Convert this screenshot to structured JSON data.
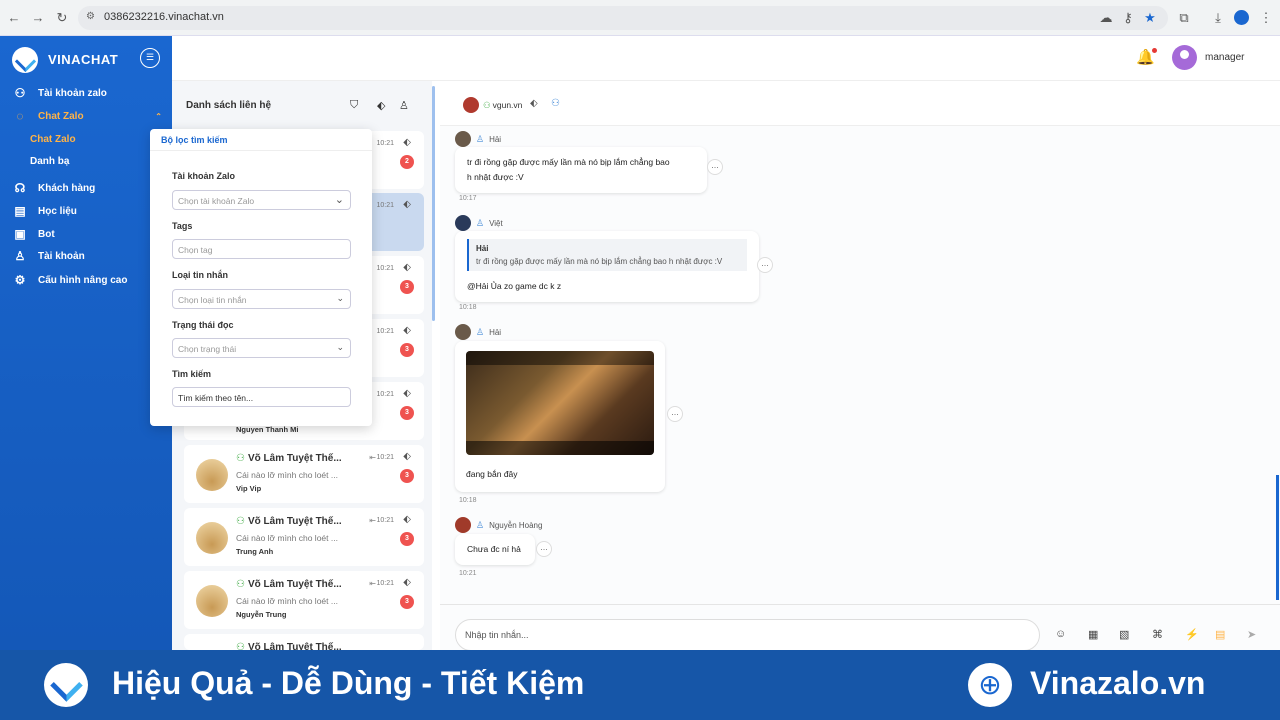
{
  "browser": {
    "url": "0386232216.vinachat.vn"
  },
  "sidebar": {
    "brand": "VINACHAT",
    "items": [
      {
        "label": "Tài khoản zalo"
      },
      {
        "label": "Chat Zalo"
      },
      {
        "label": "Chat Zalo"
      },
      {
        "label": "Danh bạ"
      },
      {
        "label": "Khách hàng"
      },
      {
        "label": "Học liệu"
      },
      {
        "label": "Bot"
      },
      {
        "label": "Tài khoản"
      },
      {
        "label": "Cấu hình nâng cao"
      }
    ]
  },
  "header": {
    "username": "manager"
  },
  "contacts": {
    "title": "Danh sách liên hệ",
    "cards": [
      {
        "time": "10:21",
        "badge": "2"
      },
      {
        "time": "10:21"
      },
      {
        "time": "10:21",
        "badge": "3"
      },
      {
        "time": "10:21",
        "badge": "3"
      },
      {
        "time": "10:21",
        "badge": "3",
        "sub": "Nguyen Thanh Mi"
      },
      {
        "name": "Võ Lâm Tuyệt Thế...",
        "preview": "Cái nào lỡ mình cho loét ...",
        "sub": "Vip Vip",
        "time": "10:21",
        "badge": "3"
      },
      {
        "name": "Võ Lâm Tuyệt Thế...",
        "preview": "Cái nào lỡ mình cho loét ...",
        "sub": "Trung Anh",
        "time": "10:21",
        "badge": "3"
      },
      {
        "name": "Võ Lâm Tuyệt Thế...",
        "preview": "Cái nào lỡ mình cho loét ...",
        "sub": "Nguyễn Trung",
        "time": "10:21",
        "badge": "3"
      },
      {
        "name": "Võ Lâm Tuyệt Thế..."
      }
    ]
  },
  "filter": {
    "title": "Bộ lọc tìm kiếm",
    "account_label": "Tài khoản Zalo",
    "account_placeholder": "Chọn tài khoản Zalo",
    "tags_label": "Tags",
    "tags_placeholder": "Chọn tag",
    "msgtype_label": "Loại tin nhắn",
    "msgtype_placeholder": "Chọn loại tin nhắn",
    "read_label": "Trạng thái đọc",
    "read_placeholder": "Chọn trạng thái",
    "search_label": "Tìm kiếm",
    "search_placeholder": "Tìm kiếm theo tên..."
  },
  "chat": {
    "contact_name": "vgun.vn",
    "messages": [
      {
        "sender": "Hải",
        "text1": "tr đi rồng gặp được mấy lần mà nó bịp lắm chẳng bao",
        "text2": "h nhật được :V",
        "time": "10:17"
      },
      {
        "sender": "Việt",
        "quote_author": "Hải",
        "quote_text": "tr đi rồng gặp được mấy lần mà nó bịp lắm chẳng bao h nhật được :V",
        "text": "@Hải Ủa zo game dc k z",
        "time": "10:18"
      },
      {
        "sender": "Hải",
        "caption": "đang bắn đây",
        "time": "10:18"
      },
      {
        "sender": "Nguyễn Hoàng",
        "text": "Chưa đc ní hả",
        "time": "10:21"
      }
    ],
    "input_placeholder": "Nhập tin nhắn..."
  },
  "banner": {
    "slogan": "Hiệu Quả - Dễ Dùng - Tiết Kiệm",
    "site": "Vinazalo.vn"
  },
  "colors": {
    "primary": "#1a67d0",
    "accent": "#ffb347",
    "badge": "#ef5350",
    "banner": "#1656a8"
  }
}
